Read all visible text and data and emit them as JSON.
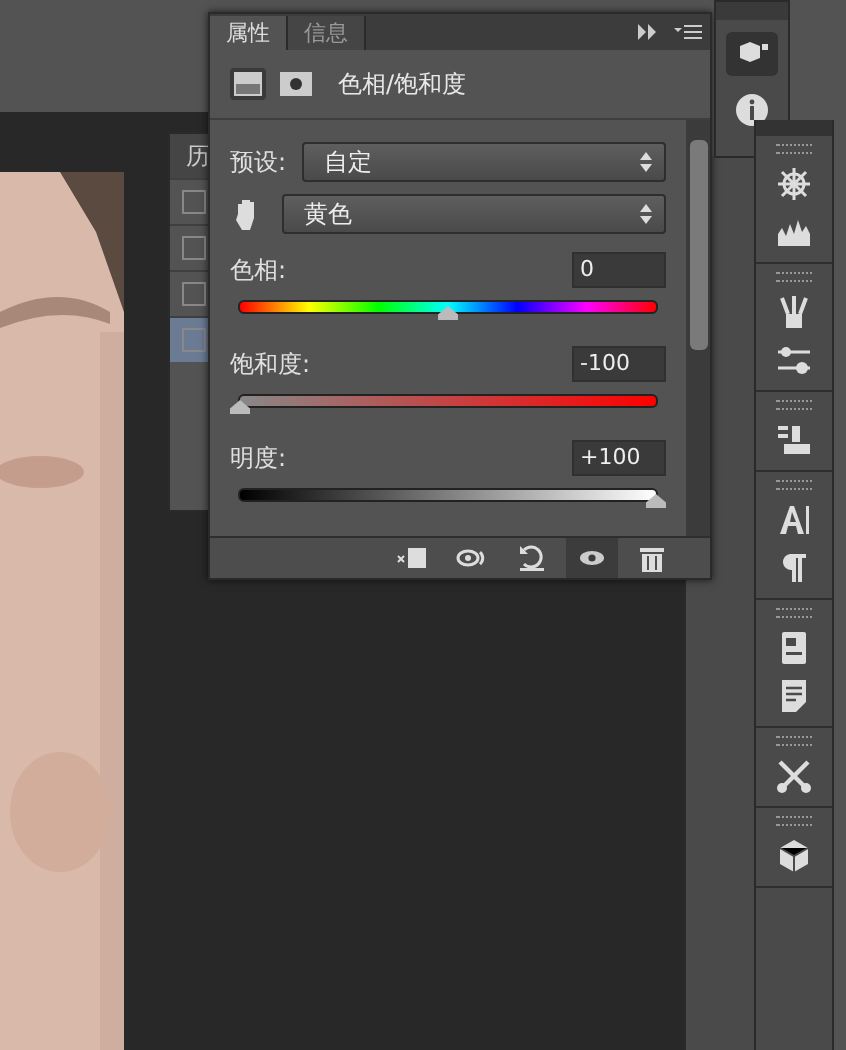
{
  "properties_panel": {
    "tabs": [
      {
        "label": "属性",
        "selected": true
      },
      {
        "label": "信息",
        "selected": false
      }
    ],
    "header": {
      "title": "色相/饱和度"
    },
    "preset": {
      "label": "预设:",
      "value": "自定"
    },
    "channel": {
      "value": "黄色"
    },
    "sliders": [
      {
        "kind": "hue",
        "label": "色相:",
        "value": "0",
        "level": 0.5
      },
      {
        "kind": "saturation",
        "label": "饱和度:",
        "value": "-100",
        "level": 0
      },
      {
        "kind": "lightness",
        "label": "明度:",
        "value": "+100",
        "level": 1
      }
    ],
    "footer_buttons": [
      {
        "kind": "clip",
        "selected": false
      },
      {
        "kind": "view-previous",
        "selected": false
      },
      {
        "kind": "reset",
        "selected": false
      },
      {
        "kind": "visibility",
        "selected": true
      },
      {
        "kind": "delete",
        "selected": false
      }
    ]
  },
  "history_panel": {
    "tab": "历",
    "items": [
      {
        "selected": false
      },
      {
        "selected": false
      },
      {
        "selected": false
      },
      {
        "selected": true
      }
    ]
  }
}
